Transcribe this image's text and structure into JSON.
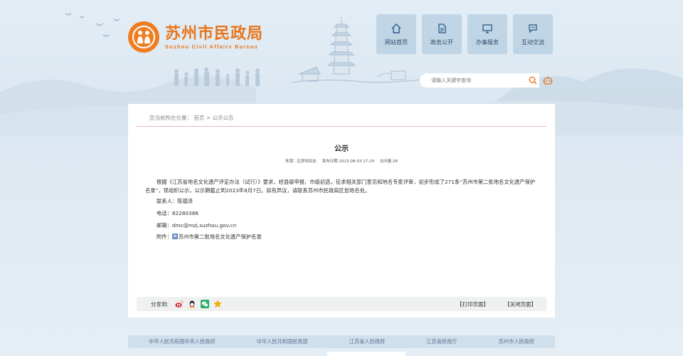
{
  "site": {
    "name_cn": "苏州市民政局",
    "name_en": "Suzhou Civil Affairs Bureau"
  },
  "nav": [
    {
      "label": "网站首页",
      "icon": "home-icon"
    },
    {
      "label": "政务公开",
      "icon": "document-icon"
    },
    {
      "label": "办事服务",
      "icon": "monitor-icon"
    },
    {
      "label": "互动交流",
      "icon": "chat-icon"
    }
  ],
  "search": {
    "placeholder": "请输入关键字查询"
  },
  "breadcrumb": {
    "prefix": "您当前所在位置：",
    "home": "首页",
    "sep": ">",
    "current": "公示公告"
  },
  "article": {
    "title": "公示",
    "source": "来源：区划地名处",
    "date": "发布日期 2023-08-03 17:29",
    "views": "访问量:28",
    "paragraph": "根据《江苏省地名文化遗产评定办法（试行）》要求，经县级申报、市级初选，征求相关部门意见和地名专家评审，初步形成了271条“苏州市第二批地名文化遗产保护名录”，现组织公示，公示期截止到2023年8月7日。如有异议，请联系苏州市民政局区划地名处。",
    "contact": "联系人：陈德泽",
    "phone": "电话：82280386",
    "email": "邮箱：dmc@mzj.suzhou.gov.cn",
    "attachment_label": "附件：",
    "attachment_name": "苏州市第二批地名文化遗产保护名录"
  },
  "share": {
    "label": "分享到:",
    "print": "【打印页面】",
    "close": "【关闭页面】"
  },
  "footer": {
    "links": [
      "中华人民共和国中央人民政府",
      "中华人民共和国民政部",
      "江苏省人民政府",
      "江苏省民政厅",
      "苏州市人民政府"
    ]
  },
  "colors": {
    "brand_orange": "#e8761c",
    "nav_bg": "#b4cde1",
    "weibo": "#e6162d",
    "wechat": "#2aae67",
    "star": "#f5b400"
  }
}
